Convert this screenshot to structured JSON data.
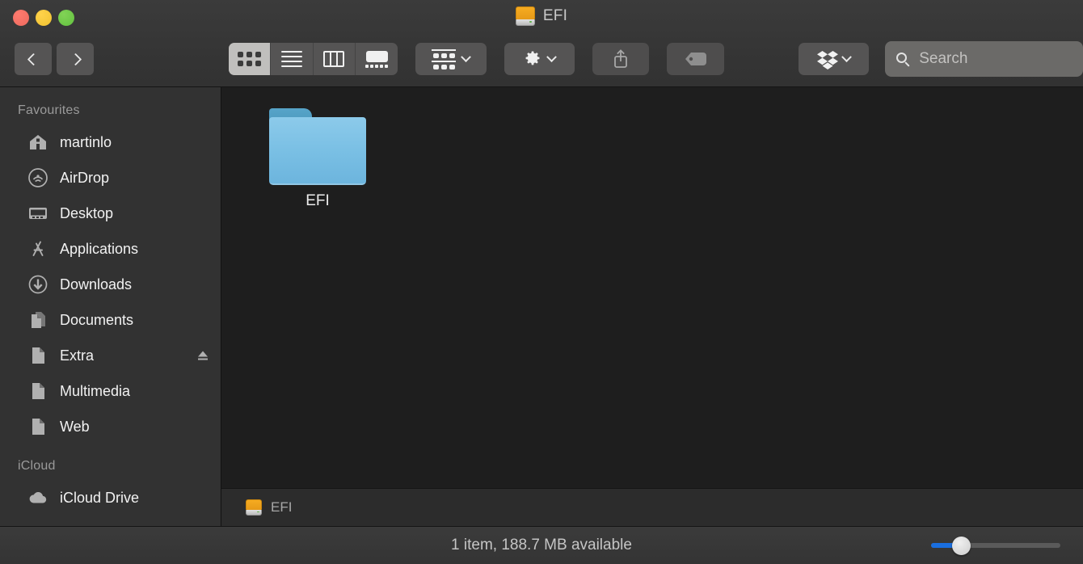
{
  "window": {
    "title": "EFI",
    "title_icon": "external-drive-icon",
    "traffic_lights": [
      {
        "name": "close",
        "color": "#ec6a5e"
      },
      {
        "name": "minimize",
        "color": "#f0c231"
      },
      {
        "name": "zoom",
        "color": "#61c13f"
      }
    ]
  },
  "toolbar": {
    "back_label": "Back",
    "forward_label": "Forward",
    "view_modes": [
      {
        "id": "icon",
        "label": "Icon View",
        "selected": true
      },
      {
        "id": "list",
        "label": "List View",
        "selected": false
      },
      {
        "id": "column",
        "label": "Column View",
        "selected": false
      },
      {
        "id": "gallery",
        "label": "Gallery View",
        "selected": false
      }
    ],
    "group_label": "Group",
    "action_label": "Action",
    "share_label": "Share",
    "tag_label": "Tags",
    "dropbox_label": "Dropbox"
  },
  "search": {
    "placeholder": "Search",
    "value": ""
  },
  "sidebar": {
    "sections": [
      {
        "header": "Favourites",
        "items": [
          {
            "label": "martinlo",
            "icon": "home-icon",
            "eject": false
          },
          {
            "label": "AirDrop",
            "icon": "airdrop-icon",
            "eject": false
          },
          {
            "label": "Desktop",
            "icon": "desktop-icon",
            "eject": false
          },
          {
            "label": "Applications",
            "icon": "applications-icon",
            "eject": false
          },
          {
            "label": "Downloads",
            "icon": "downloads-icon",
            "eject": false
          },
          {
            "label": "Documents",
            "icon": "documents-icon",
            "eject": false
          },
          {
            "label": "Extra",
            "icon": "document-icon",
            "eject": true
          },
          {
            "label": "Multimedia",
            "icon": "document-icon",
            "eject": false
          },
          {
            "label": "Web",
            "icon": "document-icon",
            "eject": false
          }
        ]
      },
      {
        "header": "iCloud",
        "items": [
          {
            "label": "iCloud Drive",
            "icon": "cloud-icon",
            "eject": false
          }
        ]
      }
    ]
  },
  "main": {
    "files": [
      {
        "name": "EFI",
        "icon": "folder-icon",
        "selected": false
      }
    ]
  },
  "pathbar": {
    "crumbs": [
      {
        "label": "EFI",
        "icon": "external-drive-icon"
      }
    ]
  },
  "statusbar": {
    "text": "1 item, 188.7 MB available",
    "zoom_slider": {
      "value": 25,
      "min": 0,
      "max": 100,
      "fill_color": "#1a6fe0"
    }
  }
}
